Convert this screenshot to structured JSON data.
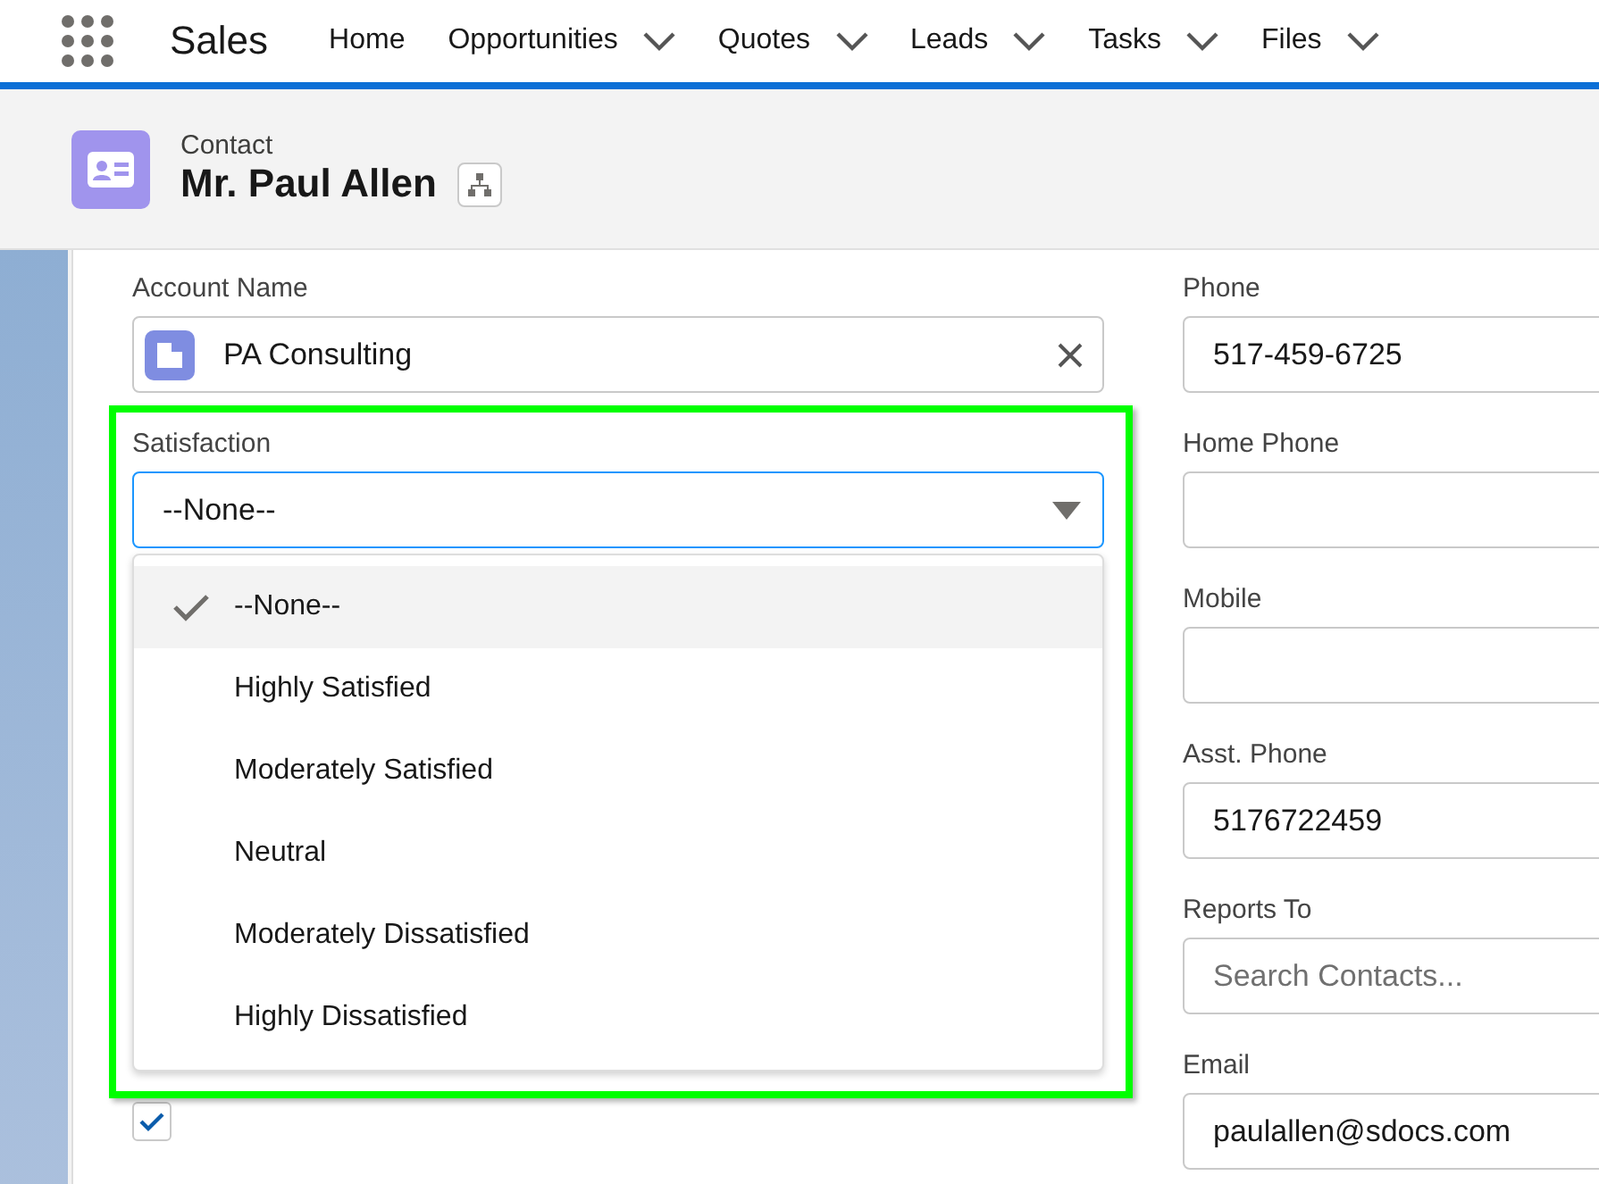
{
  "app": {
    "name": "Sales"
  },
  "nav": [
    {
      "label": "Home",
      "has_menu": false
    },
    {
      "label": "Opportunities",
      "has_menu": true
    },
    {
      "label": "Quotes",
      "has_menu": true
    },
    {
      "label": "Leads",
      "has_menu": true
    },
    {
      "label": "Tasks",
      "has_menu": true
    },
    {
      "label": "Files",
      "has_menu": true
    }
  ],
  "record": {
    "type": "Contact",
    "name": "Mr. Paul Allen"
  },
  "account": {
    "label": "Account Name",
    "value": "PA Consulting"
  },
  "satisfaction": {
    "label": "Satisfaction",
    "value": "--None--",
    "expanded": true,
    "options": [
      {
        "label": "--None--",
        "selected": true
      },
      {
        "label": "Highly Satisfied",
        "selected": false
      },
      {
        "label": "Moderately Satisfied",
        "selected": false
      },
      {
        "label": "Neutral",
        "selected": false
      },
      {
        "label": "Moderately Dissatisfied",
        "selected": false
      },
      {
        "label": "Highly Dissatisfied",
        "selected": false
      }
    ]
  },
  "subscribed": {
    "checked": true
  },
  "right_fields": [
    {
      "label": "Phone",
      "value": "517-459-6725"
    },
    {
      "label": "Home Phone"
    },
    {
      "label": "Mobile"
    },
    {
      "label": "Asst. Phone",
      "value": "5176722459"
    },
    {
      "label": "Reports To",
      "placeholder": "Search Contacts..."
    },
    {
      "label": "Email",
      "value": "paulallen@sdocs.com"
    }
  ]
}
